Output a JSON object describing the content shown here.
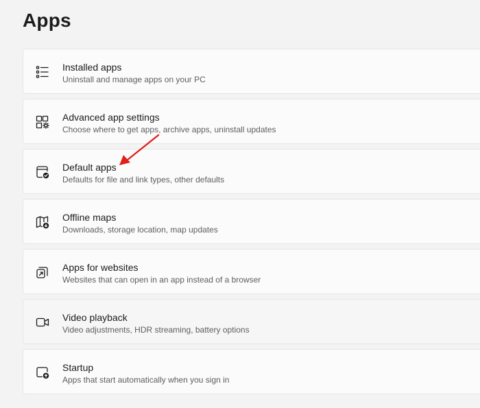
{
  "page": {
    "title": "Apps"
  },
  "items": [
    {
      "title": "Installed apps",
      "desc": "Uninstall and manage apps on your PC",
      "icon": "installed-apps-list-icon"
    },
    {
      "title": "Advanced app settings",
      "desc": "Choose where to get apps, archive apps, uninstall updates",
      "icon": "advanced-app-settings-icon"
    },
    {
      "title": "Default apps",
      "desc": "Defaults for file and link types, other defaults",
      "icon": "default-apps-icon"
    },
    {
      "title": "Offline maps",
      "desc": "Downloads, storage location, map updates",
      "icon": "offline-maps-icon"
    },
    {
      "title": "Apps for websites",
      "desc": "Websites that can open in an app instead of a browser",
      "icon": "apps-for-websites-icon"
    },
    {
      "title": "Video playback",
      "desc": "Video adjustments, HDR streaming, battery options",
      "icon": "video-playback-icon"
    },
    {
      "title": "Startup",
      "desc": "Apps that start automatically when you sign in",
      "icon": "startup-icon"
    }
  ],
  "annotation": {
    "color": "#e0201b",
    "target": "Default apps",
    "icon": "red-arrow-annotation"
  }
}
